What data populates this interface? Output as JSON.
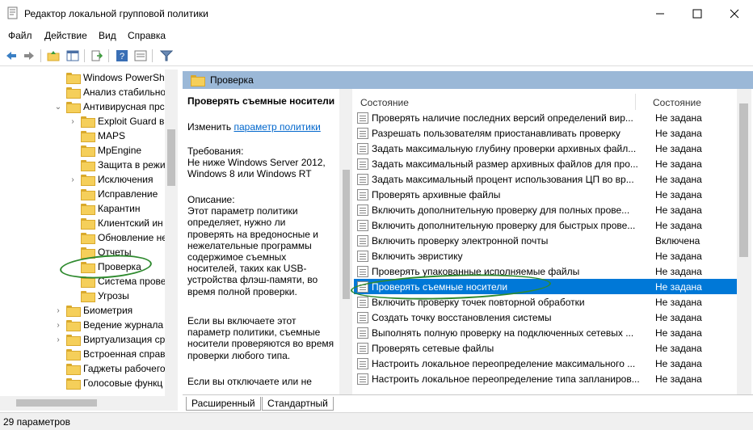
{
  "window": {
    "title": "Редактор локальной групповой политики",
    "controls": {
      "minimize": "minimize-icon",
      "maximize": "maximize-icon",
      "close": "close-icon"
    }
  },
  "menu": [
    "Файл",
    "Действие",
    "Вид",
    "Справка"
  ],
  "toolbar": [
    "back-icon",
    "forward-icon",
    "up-folder-icon",
    "show-hide-tree-icon",
    "export-icon",
    "help-icon",
    "properties-icon",
    "filter-icon"
  ],
  "tree": {
    "items": [
      {
        "label": "Windows PowerShe",
        "chevron": ""
      },
      {
        "label": "Анализ стабильно",
        "chevron": ""
      },
      {
        "label": "Антивирусная прс",
        "chevron": "⌄"
      },
      {
        "label": "Exploit Guard в",
        "chevron": "›"
      },
      {
        "label": "MAPS",
        "chevron": ""
      },
      {
        "label": "MpEngine",
        "chevron": ""
      },
      {
        "label": "Защита в режи",
        "chevron": ""
      },
      {
        "label": "Исключения",
        "chevron": "›"
      },
      {
        "label": "Исправление",
        "chevron": ""
      },
      {
        "label": "Карантин",
        "chevron": ""
      },
      {
        "label": "Клиентский ин",
        "chevron": ""
      },
      {
        "label": "Обновление не",
        "chevron": ""
      },
      {
        "label": "Отчеты",
        "chevron": ""
      },
      {
        "label": "Проверка",
        "chevron": ""
      },
      {
        "label": "Система прове",
        "chevron": ""
      },
      {
        "label": "Угрозы",
        "chevron": ""
      },
      {
        "label": "Биометрия",
        "chevron": "›"
      },
      {
        "label": "Ведение журнала",
        "chevron": "›"
      },
      {
        "label": "Виртуализация ср",
        "chevron": "›"
      },
      {
        "label": "Встроенная справ",
        "chevron": ""
      },
      {
        "label": "Гаджеты рабочего",
        "chevron": ""
      },
      {
        "label": "Голосовые функц",
        "chevron": ""
      }
    ]
  },
  "header": {
    "folder_label": "Проверка"
  },
  "description": {
    "title": "Проверять съемные носители",
    "edit_prefix": "Изменить",
    "edit_link": "параметр политики",
    "requirements": "Требования:\nНе ниже Windows Server 2012, Windows 8 или Windows RT",
    "description": "Описание:\nЭтот параметр политики определяет, нужно ли проверять на вредоносные и нежелательные программы содержимое съемных носителей, таких как USB-устройства флэш-памяти, во время полной проверки.",
    "enabled_note": "Если вы включаете этот параметр политики, съемные носители проверяются во время проверки любого типа.",
    "disabled_note": "Если вы отключаете или не"
  },
  "list": {
    "columns": [
      "Состояние",
      "Состояние"
    ],
    "rows": [
      {
        "name": "Проверять наличие последних версий определений вир...",
        "state": "Не задана"
      },
      {
        "name": "Разрешать пользователям приостанавливать проверку",
        "state": "Не задана"
      },
      {
        "name": "Задать максимальную глубину проверки архивных файл...",
        "state": "Не задана"
      },
      {
        "name": "Задать максимальный размер архивных файлов для про...",
        "state": "Не задана"
      },
      {
        "name": "Задать максимальный процент использования ЦП во вр...",
        "state": "Не задана"
      },
      {
        "name": "Проверять архивные файлы",
        "state": "Не задана"
      },
      {
        "name": "Включить дополнительную проверку для полных прове...",
        "state": "Не задана"
      },
      {
        "name": "Включить дополнительную проверку для быстрых прове...",
        "state": "Не задана"
      },
      {
        "name": "Включить проверку электронной почты",
        "state": "Включена"
      },
      {
        "name": "Включить эвристику",
        "state": "Не задана"
      },
      {
        "name": "Проверять упакованные исполняемые файлы",
        "state": "Не задана"
      },
      {
        "name": "Проверять съемные носители",
        "state": "Не задана",
        "selected": true
      },
      {
        "name": "Включить проверку точек повторной обработки",
        "state": "Не задана"
      },
      {
        "name": "Создать точку восстановления системы",
        "state": "Не задана"
      },
      {
        "name": "Выполнять полную проверку на подключенных сетевых ...",
        "state": "Не задана"
      },
      {
        "name": "Проверять сетевые файлы",
        "state": "Не задана"
      },
      {
        "name": "Настроить локальное переопределение максимального ...",
        "state": "Не задана"
      },
      {
        "name": "Настроить локальное переопределение типа запланиров...",
        "state": "Не задана"
      }
    ]
  },
  "tabs": [
    "Расширенный",
    "Стандартный"
  ],
  "status": "29 параметров",
  "colors": {
    "selection": "#0078d7",
    "header": "#9bb8d7",
    "marker": "#2f8a2f",
    "link": "#0066cc"
  }
}
